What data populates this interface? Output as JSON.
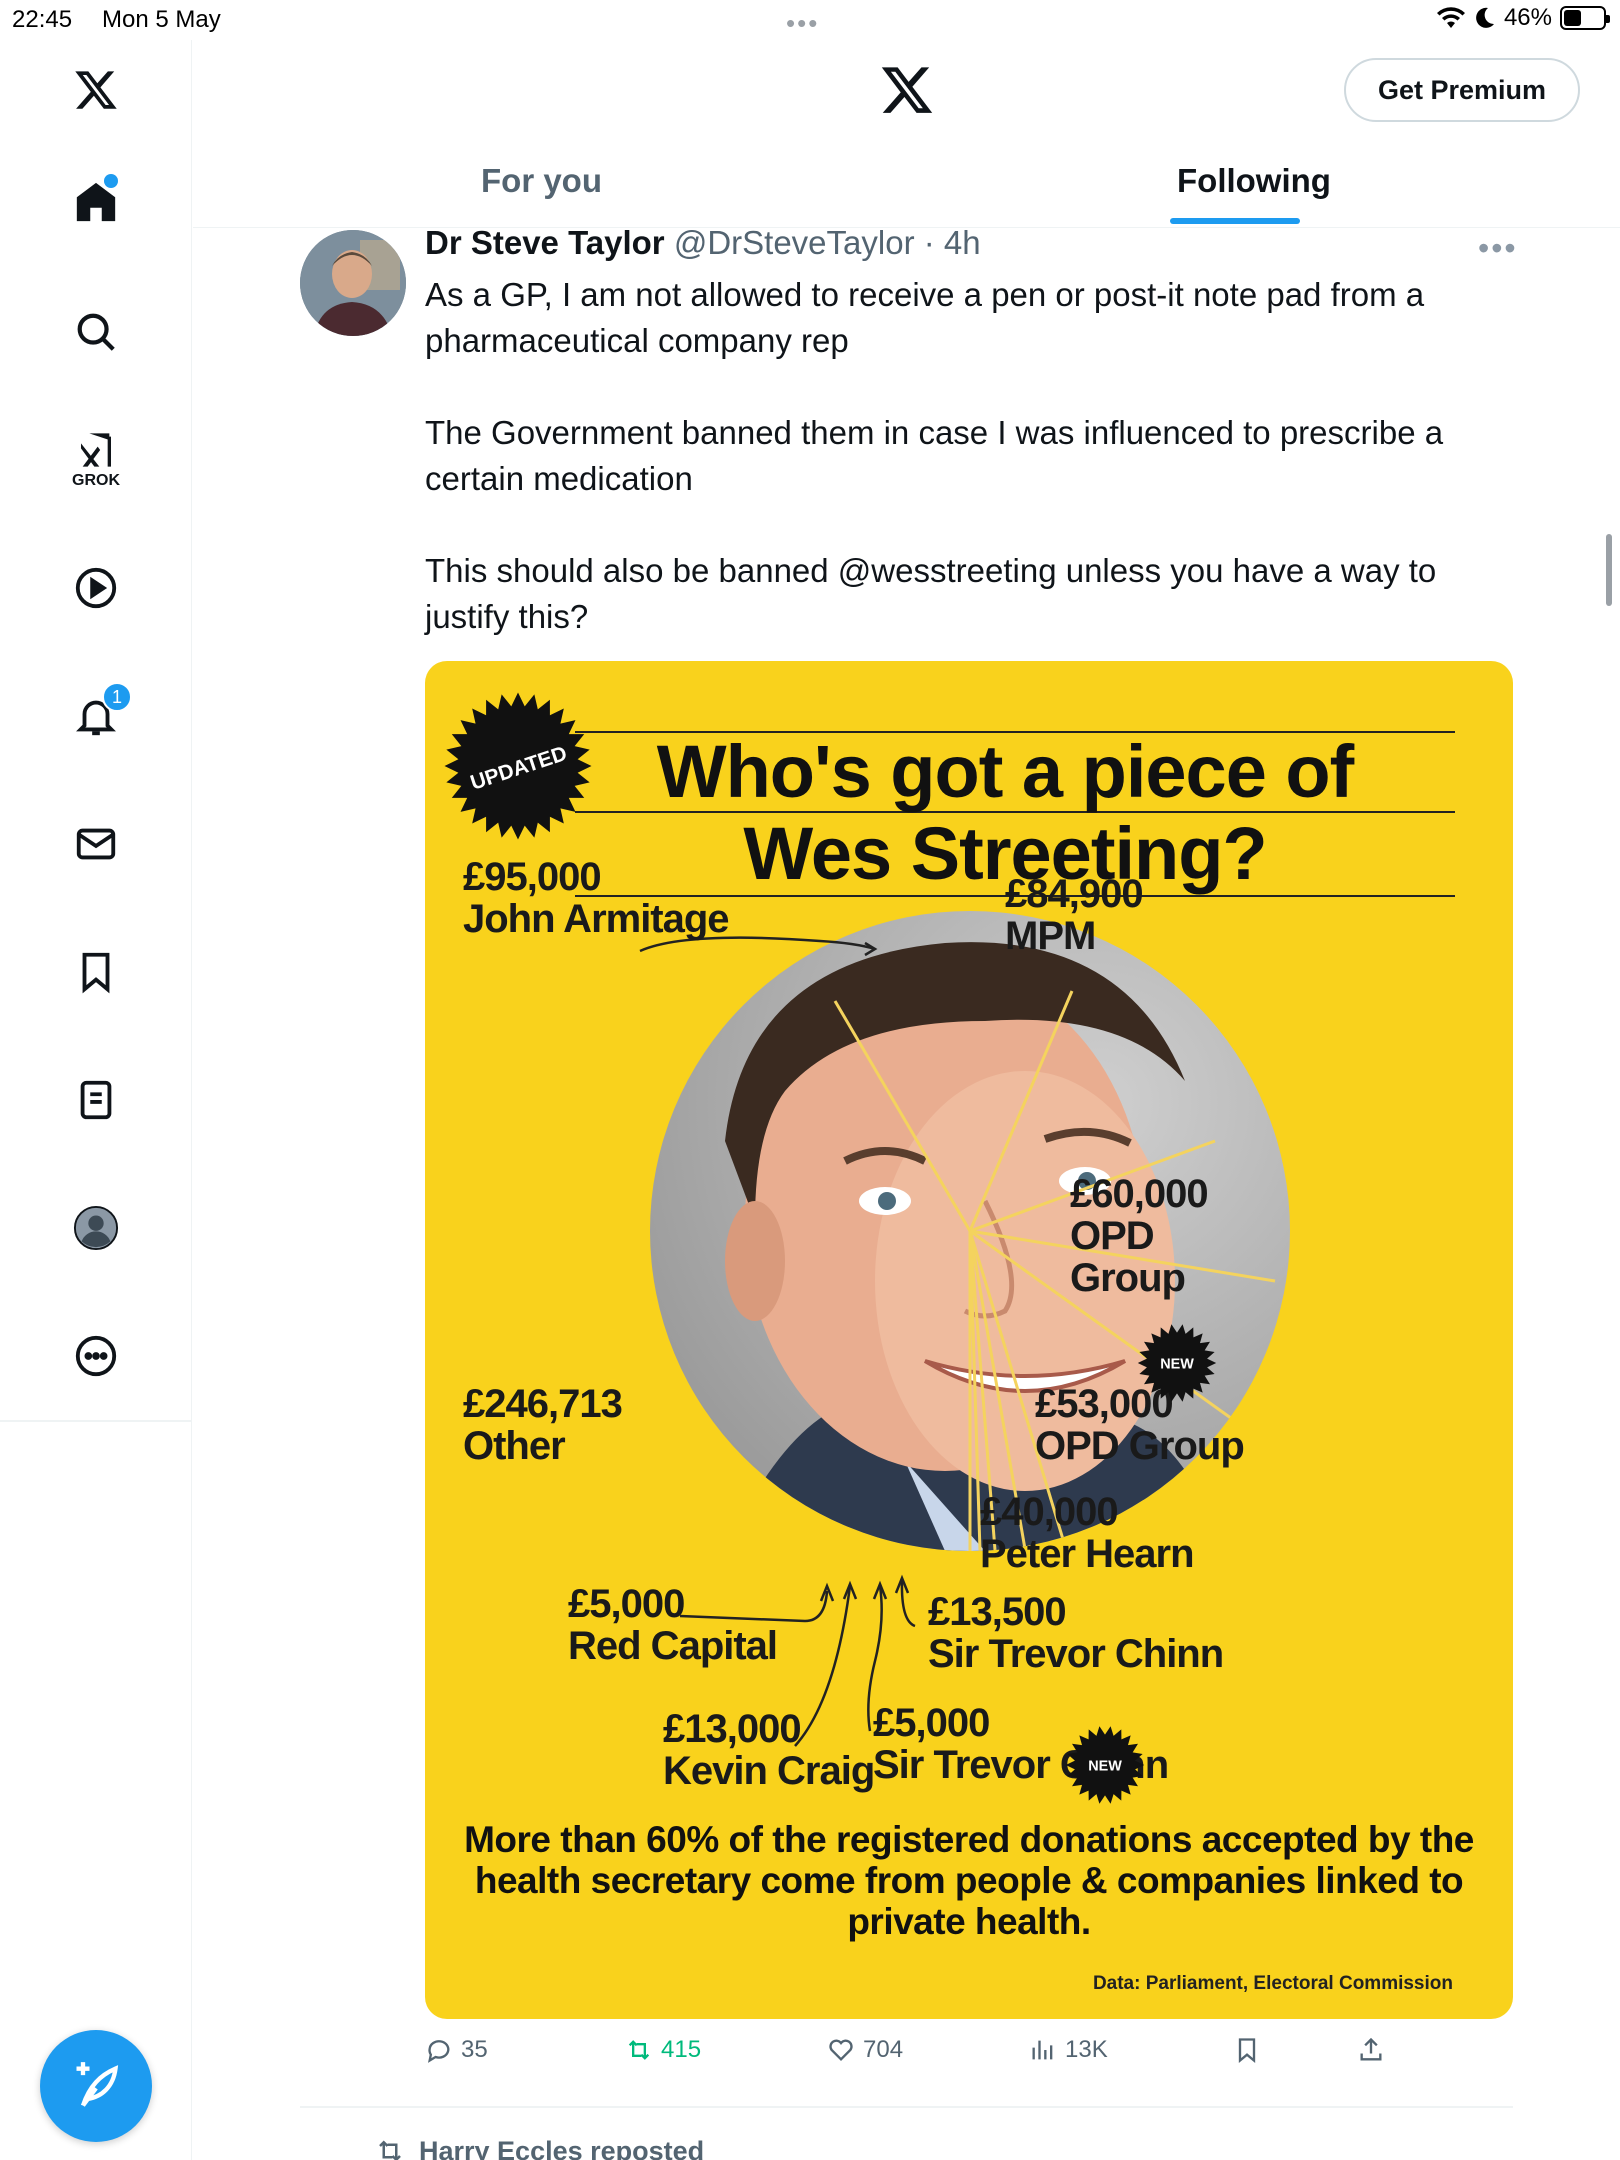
{
  "status_bar": {
    "time": "22:45",
    "date": "Mon 5 May",
    "battery": "46%",
    "battery_level": 0.46
  },
  "nav": {
    "grok_label": "GROK",
    "notifications_count": "1",
    "items": [
      "x-logo-icon",
      "home-icon",
      "search-icon",
      "grok-icon",
      "video-icon",
      "bell-icon",
      "mail-icon",
      "bookmark-icon",
      "lists-icon",
      "profile-icon",
      "more-icon"
    ],
    "compose_icon": "feather-plus-icon"
  },
  "header": {
    "premium_label": "Get Premium",
    "tabs": [
      {
        "label": "For you",
        "active": false
      },
      {
        "label": "Following",
        "active": true
      }
    ]
  },
  "tweet": {
    "name": "Dr Steve Taylor",
    "handle": "@DrSteveTaylor",
    "time": "· 4h",
    "text": "As a GP, I am not allowed to receive a pen or post-it note pad from a pharmaceutical company rep\n\nThe Government banned them in case I was influenced to prescribe a certain medication\n\nThis should also be banned @wesstreeting unless you have a way to justify this?",
    "image": {
      "stamp_updated": "UPDATED",
      "title_line1": "Who's got a piece of",
      "title_line2": "Wes Streeting?",
      "labels": {
        "john": [
          "£95,000",
          "John Armitage"
        ],
        "mpm": [
          "£84,900",
          "MPM"
        ],
        "opd1": [
          "£60,000",
          "OPD",
          "Group"
        ],
        "opd2": [
          "£53,000",
          "OPD Group"
        ],
        "other": [
          "£246,713",
          "Other"
        ],
        "peter": [
          "£40,000",
          "Peter Hearn"
        ],
        "trevor1": [
          "£13,500",
          "Sir Trevor Chinn"
        ],
        "red": [
          "£5,000",
          "Red Capital"
        ],
        "kevin": [
          "£13,000",
          "Kevin Craig"
        ],
        "trevor2": [
          "£5,000",
          "Sir Trevor Chinn"
        ]
      },
      "new_tag": "NEW",
      "footer": "More than 60% of the registered donations accepted by the health secretary come from people & companies linked to private health.",
      "credit": "Data: Parliament, Electoral Commission",
      "colors": {
        "background": "#f9d21c",
        "ink": "#111111",
        "lines": "#f4d35e"
      }
    },
    "stats": {
      "replies": "35",
      "reposts": "415",
      "likes": "704",
      "views": "13K"
    }
  },
  "next": {
    "repost_text": "Harry Eccles reposted"
  },
  "colors": {
    "accent": "#1d9bf0",
    "repost_green": "#00ba7c",
    "secondary_text": "#536471"
  }
}
